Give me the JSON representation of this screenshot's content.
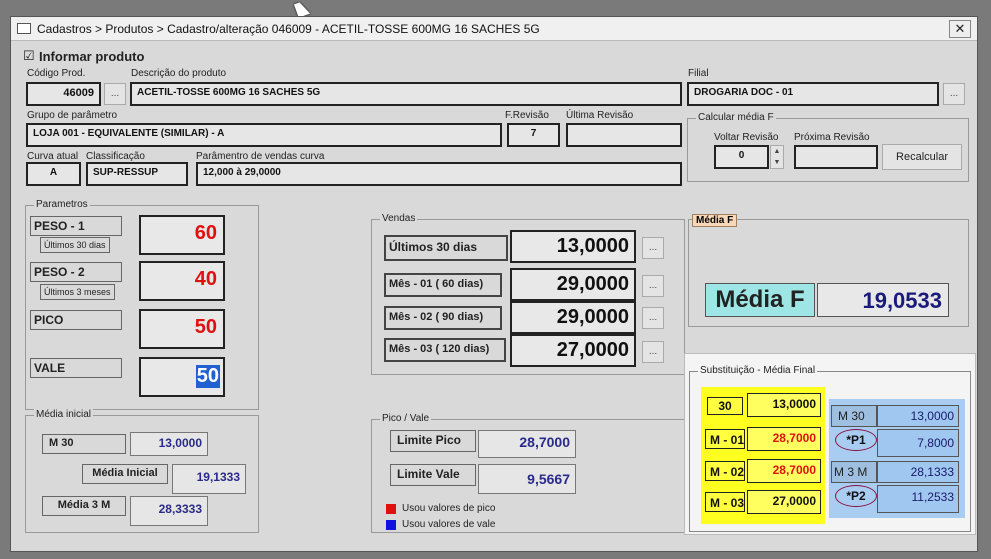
{
  "window": {
    "title": "Cadastros > Produtos > Cadastro/alteração  046009 - ACETIL-TOSSE 600MG 16 SACHES 5G",
    "close": "✕"
  },
  "informar": {
    "label": "Informar produto",
    "checked": "☑"
  },
  "produto": {
    "codigo_label": "Código Prod.",
    "codigo": "46009",
    "descricao_label": "Descrição do  produto",
    "descricao": "ACETIL-TOSSE 600MG 16 SACHES 5G",
    "filial_label": "Filial",
    "filial": "DROGARIA DOC - 01",
    "grupo_label": "Grupo de parâmetro",
    "grupo": "LOJA 001 - EQUIVALENTE (SIMILAR) - A",
    "frevisao_label": "F.Revisão",
    "frevisao": "7",
    "ultima_label": "Última Revisão",
    "ultima": "",
    "curva_label": "Curva atual",
    "curva": "A",
    "classif_label": "Classificação",
    "classif": "SUP-RESSUP",
    "param_label": "Parâmentro de vendas curva",
    "param": "12,000  à   29,0000",
    "dots": "..."
  },
  "calcular": {
    "title": "Calcular média F",
    "voltar_label": "Voltar Revisão",
    "voltar": "0",
    "proxima_label": "Próxima Revisão",
    "proxima": "",
    "recalc": "Recalcular"
  },
  "parametros": {
    "title": "Parametros",
    "items": [
      {
        "label": "PESO - 1",
        "sub": "Últimos 30 dias",
        "value": "60"
      },
      {
        "label": "PESO - 2",
        "sub": "Últimos 3 meses",
        "value": "40"
      },
      {
        "label": "PICO",
        "sub": "",
        "value": "50"
      },
      {
        "label": "VALE",
        "sub": "",
        "value": "50"
      }
    ]
  },
  "vendas": {
    "title": "Vendas",
    "rows": [
      {
        "label": "Últimos 30 dias",
        "value": "13,0000"
      },
      {
        "label": "Mês - 01 ( 60 dias)",
        "value": "29,0000"
      },
      {
        "label": "Mês - 02 ( 90 dias)",
        "value": "29,0000"
      },
      {
        "label": "Mês - 03 ( 120 dias)",
        "value": "27,0000"
      }
    ]
  },
  "mediaf": {
    "title": "Média F",
    "label": "Média F",
    "value": "19,0533"
  },
  "mediainicial": {
    "title": "Média inicial",
    "m30_label": "M 30",
    "m30": "13,0000",
    "mi_label": "Média Inicial",
    "mi": "19,1333",
    "m3m_label": "Média 3 M",
    "m3m": "28,3333"
  },
  "picovale": {
    "title": "Pico / Vale",
    "pico_label": "Limite Pico",
    "pico": "28,7000",
    "vale_label": "Limite Vale",
    "vale": "9,5667",
    "legend_pico": "Usou valores de pico",
    "legend_vale": "Usou valores de vale"
  },
  "substituicao": {
    "title": "Substituição - Média Final",
    "yellow": [
      {
        "label": "30",
        "value": "13,0000"
      },
      {
        "label": "M - 01",
        "value": "28,7000"
      },
      {
        "label": "M - 02",
        "value": "28,7000"
      },
      {
        "label": "M - 03",
        "value": "27,0000"
      }
    ],
    "blue": [
      {
        "label": "M 30",
        "value": "13,0000"
      },
      {
        "label": "*P1",
        "value": "7,8000"
      },
      {
        "label": "M 3 M",
        "value": "28,1333"
      },
      {
        "label": "*P2",
        "value": "11,2533"
      }
    ]
  },
  "colors": {
    "red": "#e01010",
    "navy": "#1a1a7a",
    "yellow": "#ffff40",
    "blue": "#9fc7f0",
    "mediaf_label": "#9ee6e6"
  }
}
